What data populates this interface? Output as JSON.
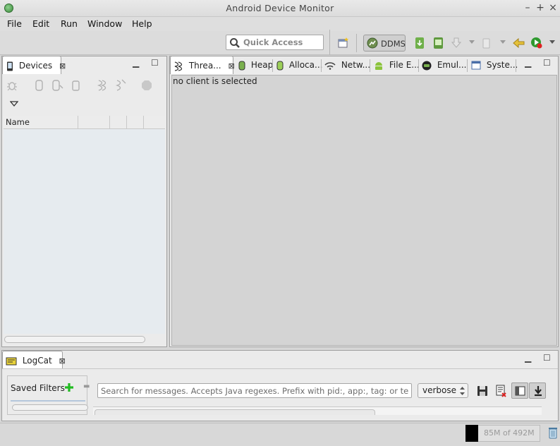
{
  "window": {
    "title": "Android Device Monitor"
  },
  "menu": {
    "items": [
      "File",
      "Edit",
      "Run",
      "Window",
      "Help"
    ]
  },
  "toolbar": {
    "quick_access_placeholder": "Quick Access",
    "perspective_label": "DDMS"
  },
  "devices_view": {
    "tab_label": "Devices",
    "column_name": "Name"
  },
  "editor_tabs": [
    {
      "label": "Threa...",
      "icon": "threads-icon",
      "active": true
    },
    {
      "label": "Heap",
      "icon": "heap-icon"
    },
    {
      "label": "Alloca...",
      "icon": "allocation-icon"
    },
    {
      "label": "Netw...",
      "icon": "network-icon"
    },
    {
      "label": "File E...",
      "icon": "android-icon"
    },
    {
      "label": "Emul...",
      "icon": "emulator-icon"
    },
    {
      "label": "Syste...",
      "icon": "system-icon"
    }
  ],
  "threads_view": {
    "empty_message": "no client is selected"
  },
  "logcat": {
    "tab_label": "LogCat",
    "saved_filters_label": "Saved Filters",
    "search_placeholder": "Search for messages. Accepts Java regexes. Prefix with pid:, app:, tag: or text: to limit scope.",
    "level": "verbose"
  },
  "status": {
    "heap_text": "85M of 492M",
    "heap_used_fraction": 0.17
  },
  "colors": {
    "accent_green": "#22bb22",
    "list_bg": "#e6ebef"
  }
}
